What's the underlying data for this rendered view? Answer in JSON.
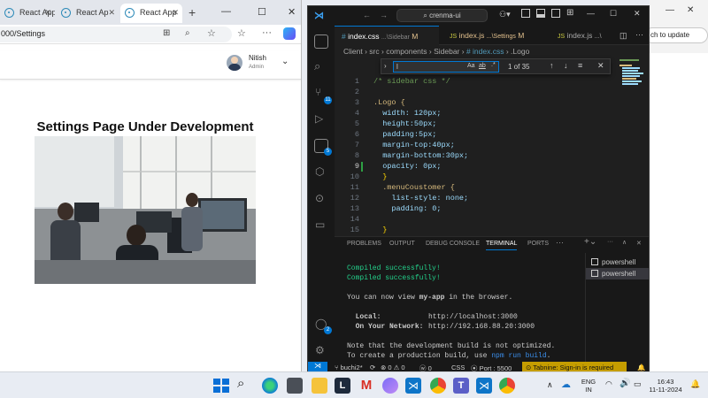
{
  "background_window": {
    "update_button": "ch to update"
  },
  "browser": {
    "tabs": [
      {
        "label": "React App"
      },
      {
        "label": "React Ap"
      },
      {
        "label": "React App"
      }
    ],
    "new_tab": "+",
    "address": "000/Settings",
    "window_controls": {
      "minimize": "—",
      "maximize": "☐",
      "close": "✕"
    },
    "user": {
      "name": "Nitish",
      "role": "Admin"
    },
    "page_title": "Settings Page Under Development"
  },
  "vscode": {
    "search": "crenma-ui",
    "tabs": [
      {
        "icon": "#",
        "name": "index.css",
        "path": "...\\Sidebar",
        "badge": "M"
      },
      {
        "icon": "JS",
        "name": "index.js",
        "path": "...\\Settings",
        "badge": "M"
      },
      {
        "icon": "JS",
        "name": "index.js",
        "path": "...\\",
        "badge": ""
      }
    ],
    "breadcrumb": [
      "Client",
      "src",
      "components",
      "Sidebar",
      "# index.css",
      ".Logo"
    ],
    "find": {
      "value": "l",
      "count": "1 of 35",
      "case": "Aa",
      "word": "ab",
      "regex": ".*"
    },
    "code_lines": [
      {
        "n": "1",
        "text": "/* sidebar css */"
      },
      {
        "n": "2",
        "text": ""
      },
      {
        "n": "3",
        "text": ".Logo {"
      },
      {
        "n": "4",
        "text": "  width: 120px;"
      },
      {
        "n": "5",
        "text": "  height:50px;"
      },
      {
        "n": "6",
        "text": "  padding:5px;"
      },
      {
        "n": "7",
        "text": "  margin-top:40px;"
      },
      {
        "n": "8",
        "text": "  margin-bottom:30px;"
      },
      {
        "n": "9",
        "text": "  opacity: 0px;"
      },
      {
        "n": "10",
        "text": "  }"
      },
      {
        "n": "11",
        "text": "  .menuCoustomer {"
      },
      {
        "n": "12",
        "text": "    list-style: none;"
      },
      {
        "n": "13",
        "text": "    padding: 0;"
      },
      {
        "n": "14",
        "text": ""
      },
      {
        "n": "15",
        "text": "  }"
      }
    ],
    "panel_tabs": [
      "PROBLEMS",
      "OUTPUT",
      "DEBUG CONSOLE",
      "TERMINAL",
      "PORTS"
    ],
    "active_panel": "TERMINAL",
    "terminal": {
      "compiled_1": "Compiled successfully!",
      "compiled_2": "Compiled successfully!",
      "view_prefix": "You can now view ",
      "app_name": "my-app",
      "view_suffix": " in the browser.",
      "local_label": "  Local:",
      "local_url": "http://localhost:3000",
      "network_label": "  On Your Network:",
      "network_url": "http://192.168.88.20:3000",
      "note": "Note that the development build is not optimized.",
      "prod_prefix": "To create a production build, use ",
      "prod_cmd": "npm run build",
      "prod_suffix": "."
    },
    "terminals": [
      "powershell",
      "powershell"
    ],
    "status": {
      "branch": "buchi2*",
      "errors": "⊗ 0 ⚠ 0",
      "info": "0",
      "lang": "CSS",
      "port": "Port : 5500",
      "tabnine": "Tabnine: Sign-in is required"
    }
  },
  "taskbar": {
    "lang": "ENG",
    "region": "IN",
    "time": "16:43",
    "date": "11-11-2024"
  }
}
